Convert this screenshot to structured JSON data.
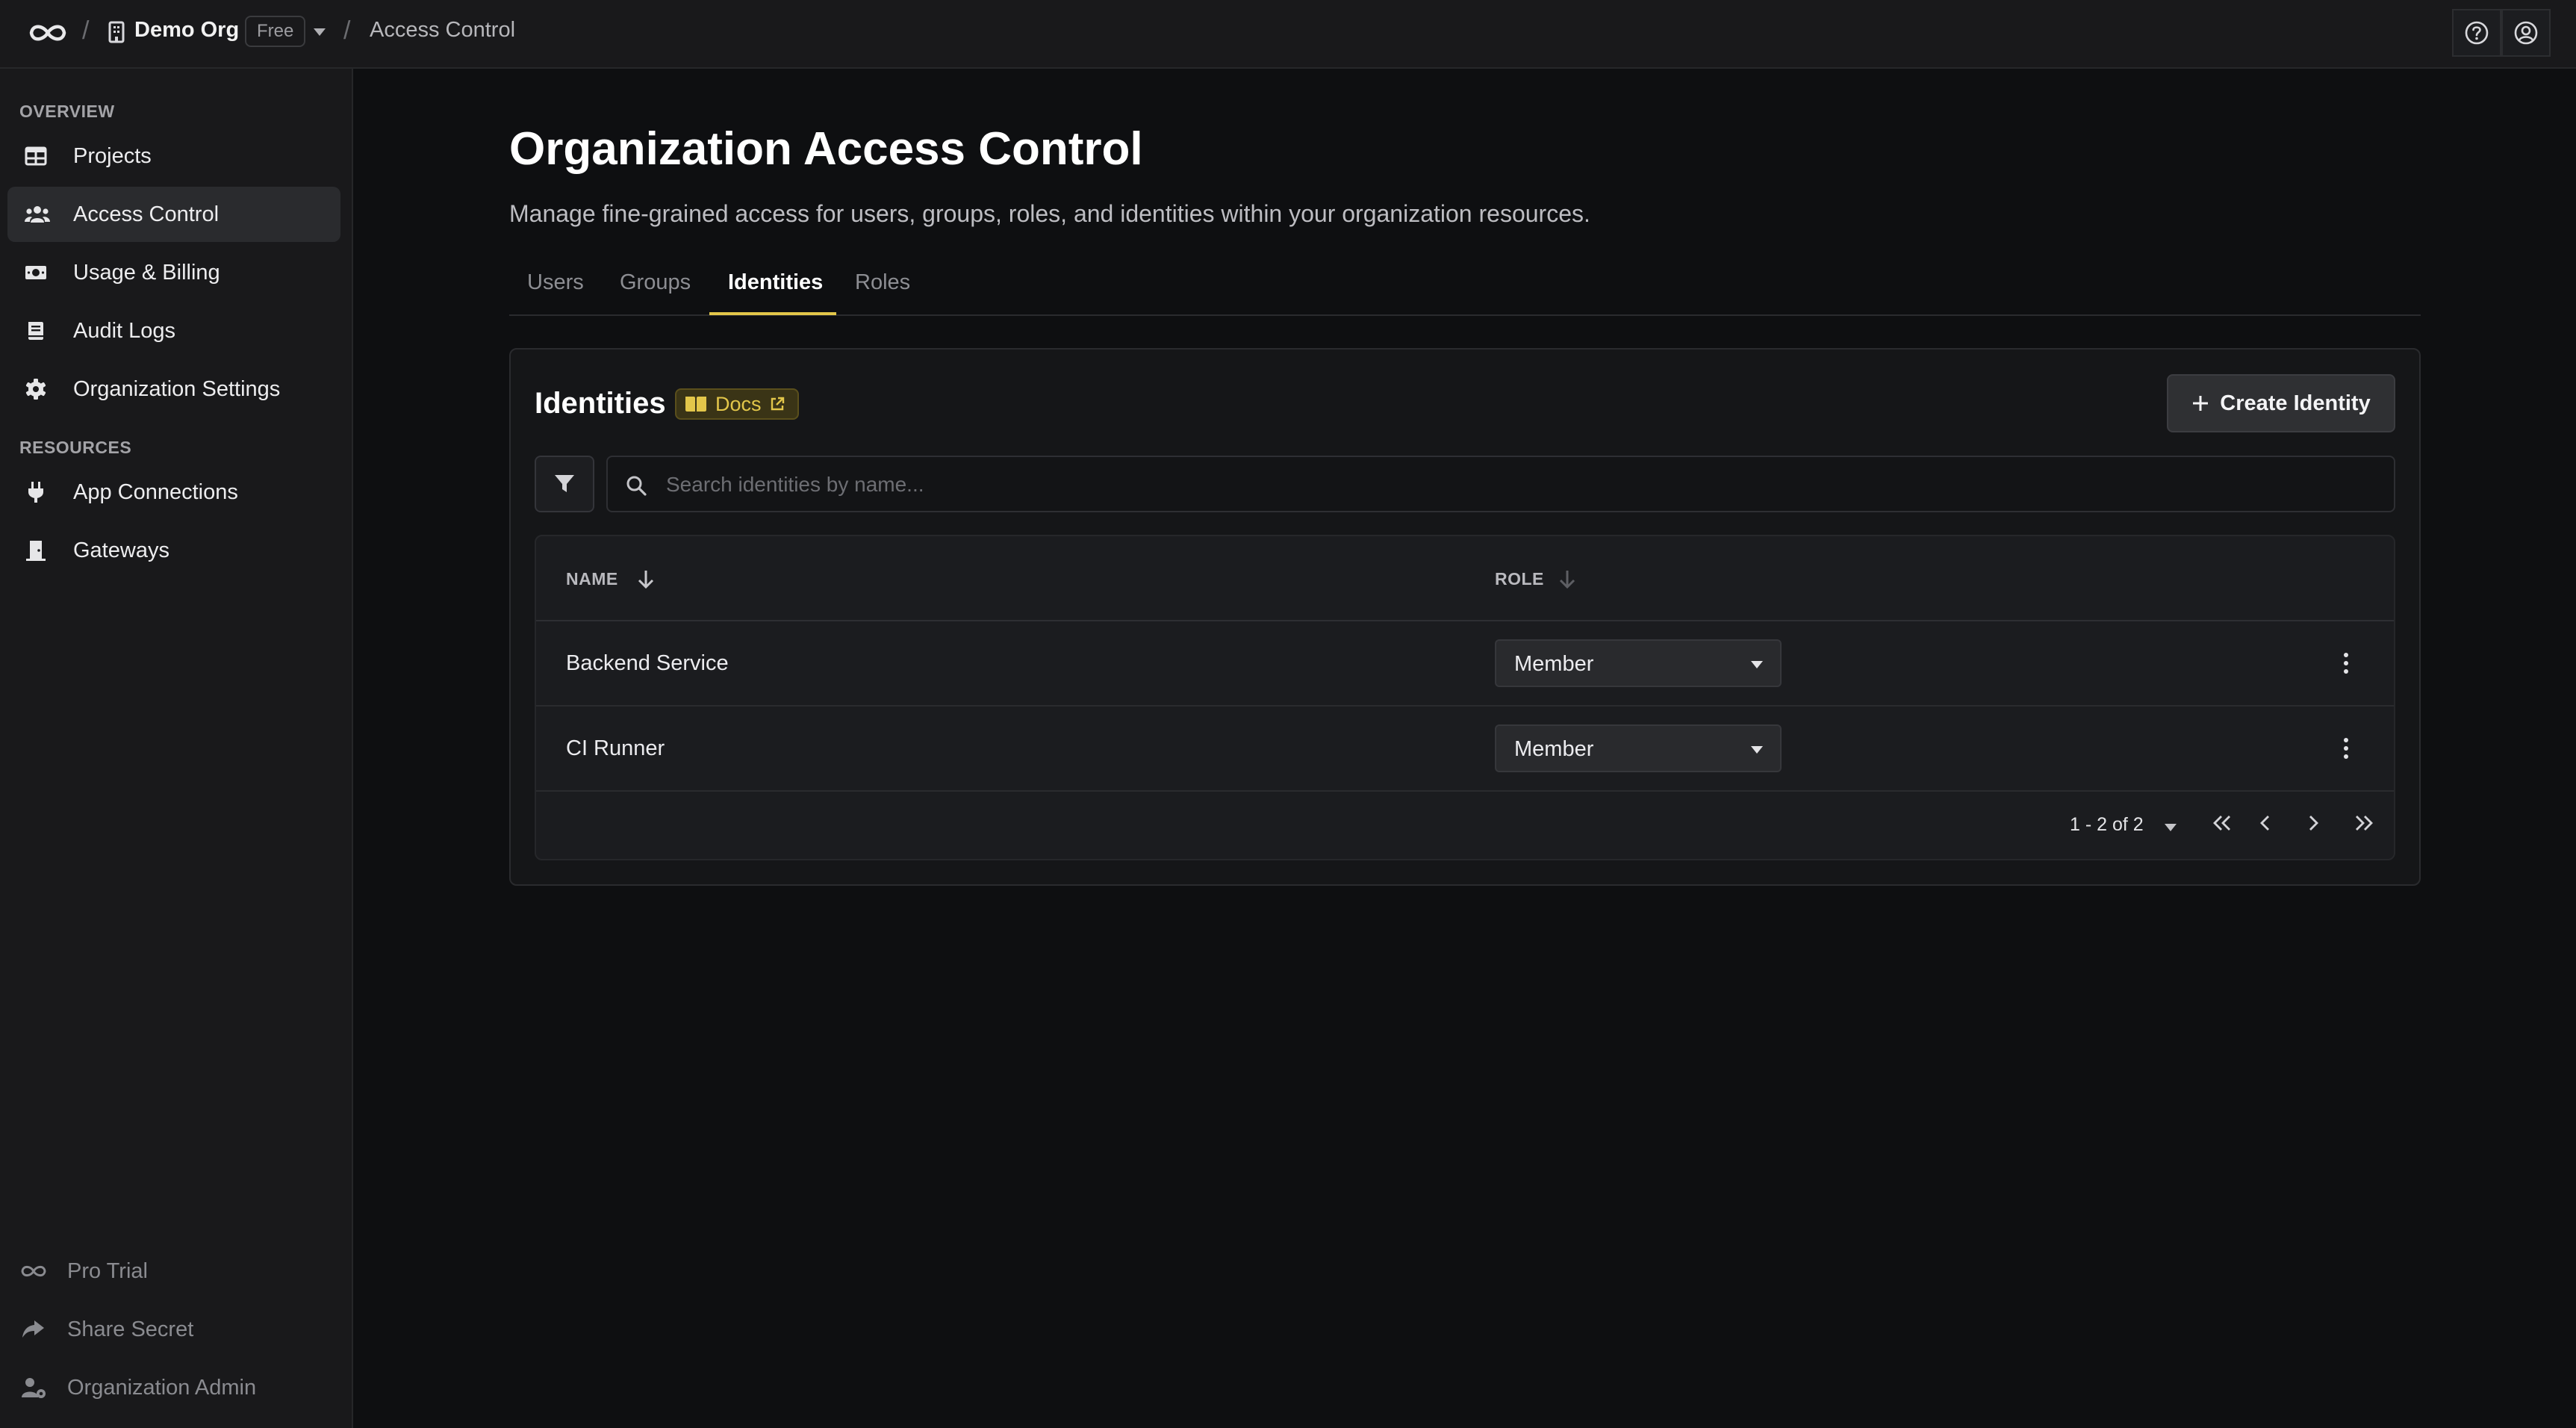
{
  "topbar": {
    "org_name": "Demo Org",
    "plan_badge": "Free",
    "separator": "/",
    "current_page": "Access Control",
    "icons": [
      "infinity-logo-icon",
      "building-icon",
      "caret-down-icon",
      "help-circle-icon",
      "user-circle-icon"
    ]
  },
  "sidebar": {
    "overview_label": "OVERVIEW",
    "overview_items": [
      {
        "label": "Projects",
        "icon": "table-icon"
      },
      {
        "label": "Access Control",
        "icon": "users-icon",
        "active": true
      },
      {
        "label": "Usage & Billing",
        "icon": "money-bill-icon"
      },
      {
        "label": "Audit Logs",
        "icon": "book-icon"
      },
      {
        "label": "Organization Settings",
        "icon": "gear-icon"
      }
    ],
    "resources_label": "RESOURCES",
    "resources_items": [
      {
        "label": "App Connections",
        "icon": "plug-icon"
      },
      {
        "label": "Gateways",
        "icon": "door-icon"
      }
    ],
    "footer_items": [
      {
        "label": "Pro Trial",
        "icon": "infinity-icon"
      },
      {
        "label": "Share Secret",
        "icon": "share-icon"
      },
      {
        "label": "Organization Admin",
        "icon": "user-gear-icon"
      }
    ]
  },
  "main": {
    "title": "Organization Access Control",
    "description": "Manage fine-grained access for users, groups, roles, and identities within your organization resources.",
    "tabs": [
      {
        "label": "Users"
      },
      {
        "label": "Groups"
      },
      {
        "label": "Identities",
        "active": true
      },
      {
        "label": "Roles"
      }
    ],
    "accent_color": "#e2c64a"
  },
  "identities": {
    "title": "Identities",
    "docs_label": "Docs",
    "create_button": "Create Identity",
    "search_placeholder": "Search identities by name...",
    "columns": [
      "NAME",
      "ROLE"
    ],
    "rows": [
      {
        "name": "Backend Service",
        "role": "Member"
      },
      {
        "name": "CI Runner",
        "role": "Member"
      }
    ],
    "pagination": "1 - 2 of 2"
  }
}
